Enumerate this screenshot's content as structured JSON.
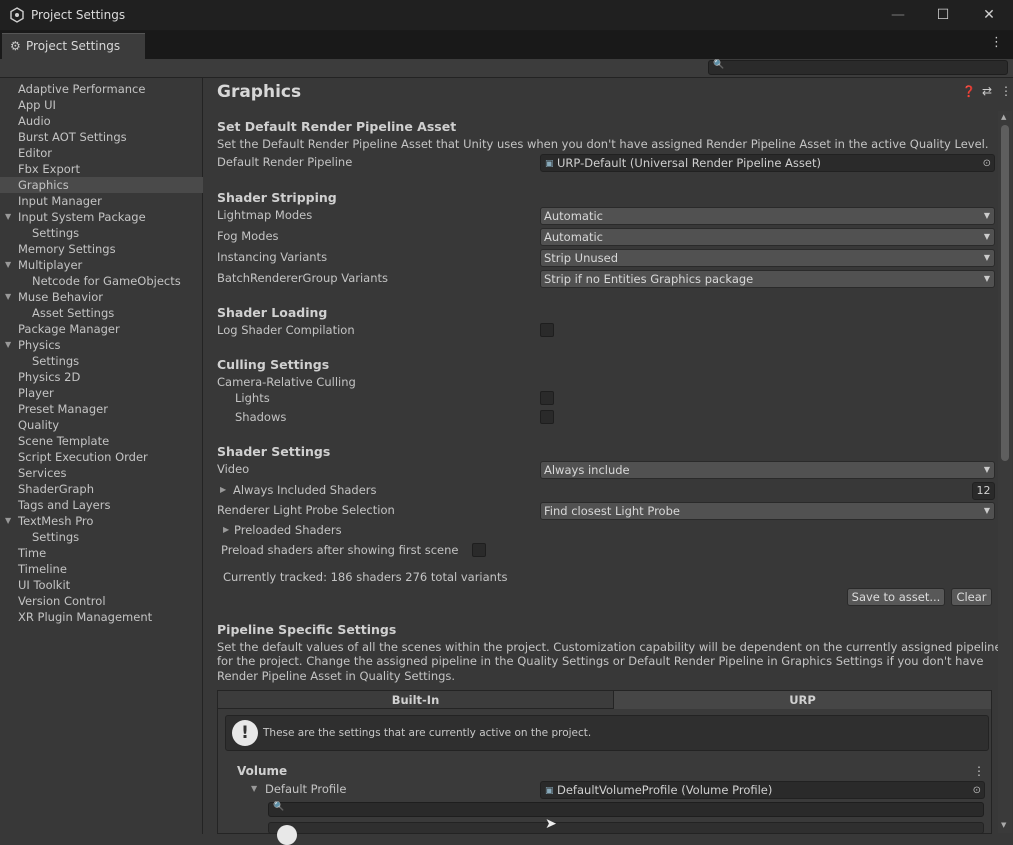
{
  "window": {
    "title": "Project Settings",
    "minimize": "—",
    "maximize": "☐",
    "close": "✕"
  },
  "tab": {
    "label": "Project Settings"
  },
  "sidebar": {
    "items": [
      {
        "label": "Adaptive Performance"
      },
      {
        "label": "App UI"
      },
      {
        "label": "Audio"
      },
      {
        "label": "Burst AOT Settings"
      },
      {
        "label": "Editor"
      },
      {
        "label": "Fbx Export"
      },
      {
        "label": "Graphics"
      },
      {
        "label": "Input Manager"
      },
      {
        "label": "Input System Package"
      },
      {
        "label": "Settings"
      },
      {
        "label": "Memory Settings"
      },
      {
        "label": "Multiplayer"
      },
      {
        "label": "Netcode for GameObjects"
      },
      {
        "label": "Muse Behavior"
      },
      {
        "label": "Asset Settings"
      },
      {
        "label": "Package Manager"
      },
      {
        "label": "Physics"
      },
      {
        "label": "Settings"
      },
      {
        "label": "Physics 2D"
      },
      {
        "label": "Player"
      },
      {
        "label": "Preset Manager"
      },
      {
        "label": "Quality"
      },
      {
        "label": "Scene Template"
      },
      {
        "label": "Script Execution Order"
      },
      {
        "label": "Services"
      },
      {
        "label": "ShaderGraph"
      },
      {
        "label": "Tags and Layers"
      },
      {
        "label": "TextMesh Pro"
      },
      {
        "label": "Settings"
      },
      {
        "label": "Time"
      },
      {
        "label": "Timeline"
      },
      {
        "label": "UI Toolkit"
      },
      {
        "label": "Version Control"
      },
      {
        "label": "XR Plugin Management"
      }
    ]
  },
  "main": {
    "title": "Graphics",
    "rp": {
      "heading": "Set Default Render Pipeline Asset",
      "desc": "Set the Default Render Pipeline Asset that Unity uses when you don't have assigned Render Pipeline Asset in the active Quality Level.",
      "label": "Default Render Pipeline",
      "value": "URP-Default (Universal Render Pipeline Asset)"
    },
    "stripping": {
      "heading": "Shader Stripping",
      "lightmap_label": "Lightmap Modes",
      "lightmap_value": "Automatic",
      "fog_label": "Fog Modes",
      "fog_value": "Automatic",
      "instancing_label": "Instancing Variants",
      "instancing_value": "Strip Unused",
      "brg_label": "BatchRendererGroup Variants",
      "brg_value": "Strip if no Entities Graphics package"
    },
    "loading": {
      "heading": "Shader Loading",
      "log_label": "Log Shader Compilation"
    },
    "culling": {
      "heading": "Culling Settings",
      "camera_label": "Camera-Relative Culling",
      "lights_label": "Lights",
      "shadows_label": "Shadows"
    },
    "shader_settings": {
      "heading": "Shader Settings",
      "video_label": "Video",
      "video_value": "Always include",
      "always_label": "Always Included Shaders",
      "always_count": "12",
      "probe_label": "Renderer Light Probe Selection",
      "probe_value": "Find closest Light Probe",
      "preloaded_label": "Preloaded Shaders",
      "preload_after_label": "Preload shaders after showing first scene",
      "tracked": "Currently tracked: 186 shaders 276 total variants",
      "save_btn": "Save to asset...",
      "clear_btn": "Clear"
    },
    "pipeline": {
      "heading": "Pipeline Specific Settings",
      "desc1": "Set the default values of all the scenes within the project. Customization capability will be dependent on the currently assigned pipeline",
      "desc2": "for the project. Change the assigned pipeline in the Quality Settings or Default Render Pipeline in Graphics Settings if you don't have",
      "desc3": "Render Pipeline Asset in Quality Settings.",
      "tab_builtin": "Built-In",
      "tab_urp": "URP",
      "info": "These are the settings that are currently active on the project.",
      "volume_heading": "Volume",
      "default_profile_label": "Default Profile",
      "default_profile_value": "DefaultVolumeProfile (Volume Profile)"
    }
  },
  "colors": {
    "background": "#383838",
    "selected": "#4a4a4a",
    "titlebar": "#202020"
  }
}
